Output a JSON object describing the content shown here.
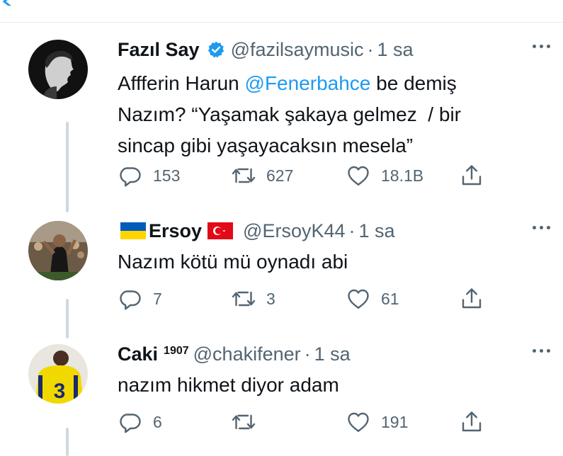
{
  "tweets": [
    {
      "name": "Fazıl Say",
      "handle": "@fazilsaymusic",
      "dot": "·",
      "time": "1 sa",
      "text_parts": {
        "before": "Affferin Harun ",
        "mention": "@Fenerbahce",
        "after": " be demiş\nNazım? “Yaşamak şakaya gelmez  / bir\nsincap gibi yaşayacaksın mesela”"
      },
      "replies": "153",
      "retweets": "627",
      "likes": "18.1B"
    },
    {
      "name": "Ersoy",
      "handle": "@ErsoyK44",
      "dot": "·",
      "time": "1 sa",
      "text": "Nazım kötü mü oynadı abi",
      "replies": "7",
      "retweets": "3",
      "likes": "61"
    },
    {
      "name": "Caki",
      "badge": "1907",
      "handle": "@chakifener",
      "dot": "·",
      "time": "1 sa",
      "text": "nazım hikmet diyor adam",
      "replies": "6",
      "retweets": "",
      "likes": "191"
    }
  ],
  "colors": {
    "link": "#1d9bf0",
    "secondary_text": "#536471",
    "thread_line": "#cfd9de"
  }
}
